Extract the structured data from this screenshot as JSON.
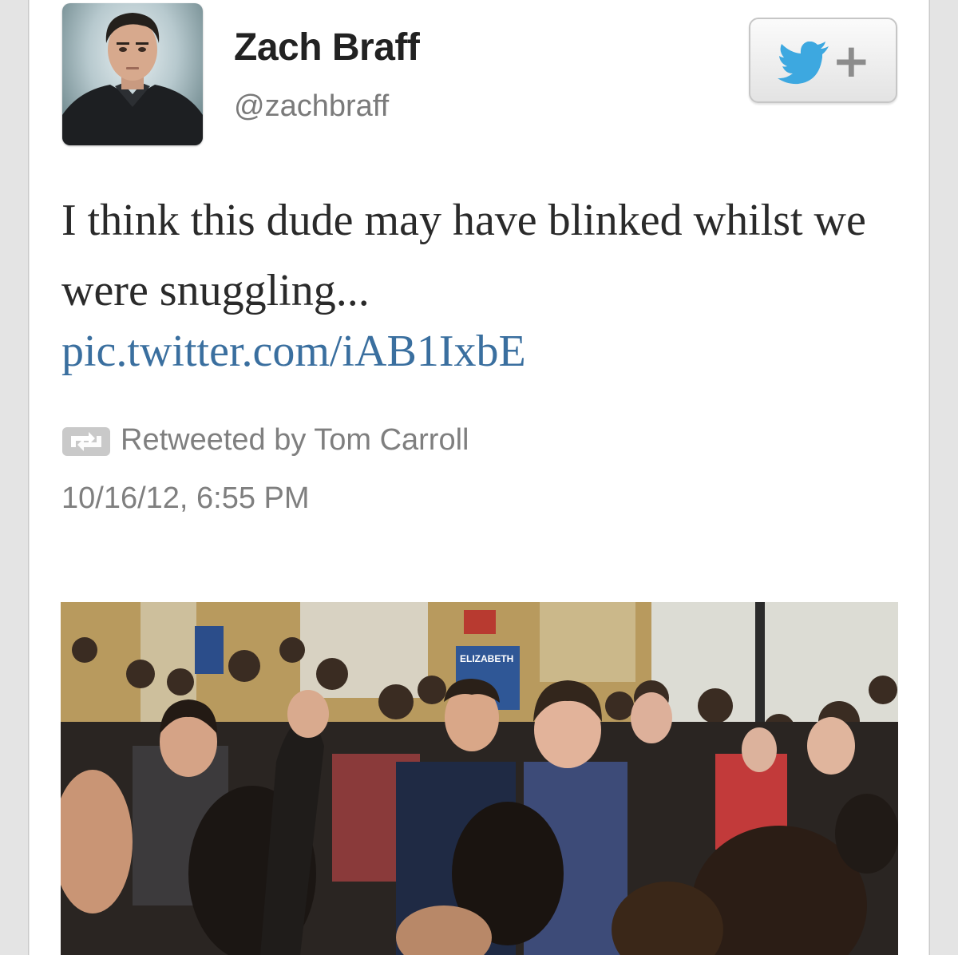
{
  "user": {
    "name": "Zach Braff",
    "handle": "@zachbraff"
  },
  "follow_button": {
    "icon": "twitter-bird-icon",
    "label": "+"
  },
  "tweet": {
    "text": "I think this dude may have blinked whilst we were snuggling...",
    "link": "pic.twitter.com/iAB1IxbE"
  },
  "retweet": {
    "icon": "retweet-icon",
    "label": "Retweeted by Tom Carroll"
  },
  "timestamp": "10/16/12, 6:55 PM",
  "photo": {
    "signs": [
      "ELIZABETH",
      "ELIZABETH"
    ]
  },
  "colors": {
    "link": "#3a6f9f",
    "bird": "#3da8e0",
    "muted": "#7f7f7f"
  }
}
